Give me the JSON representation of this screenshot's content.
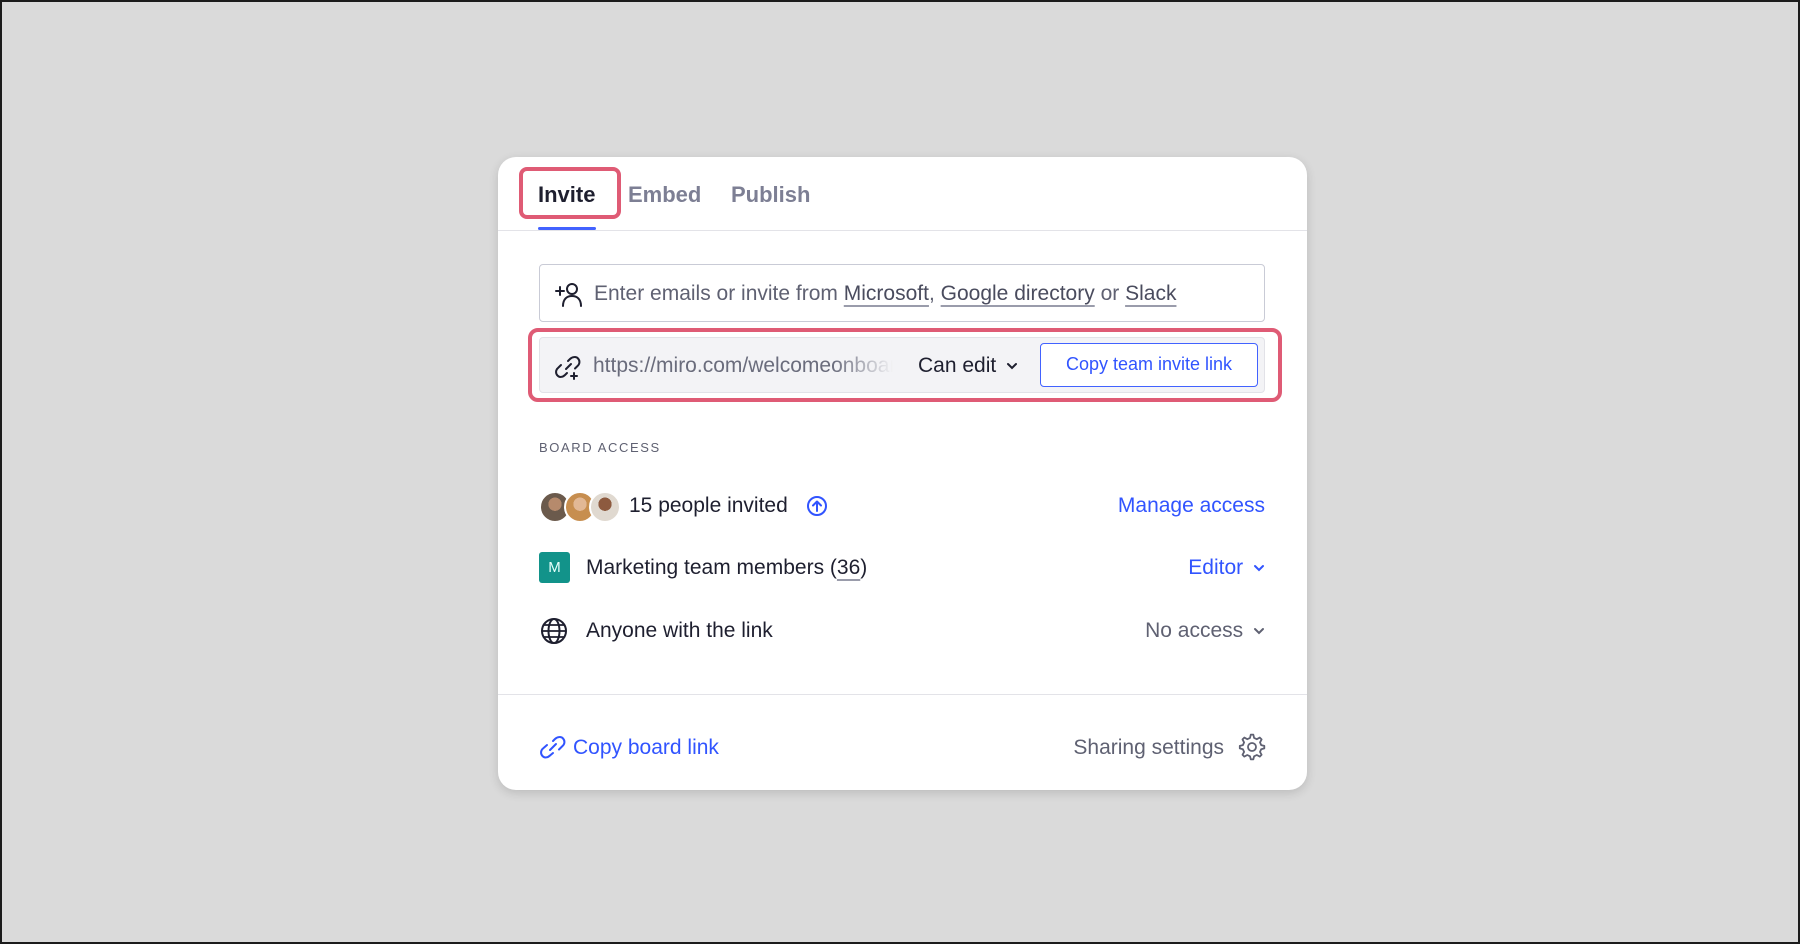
{
  "tabs": [
    {
      "label": "Invite",
      "active": true
    },
    {
      "label": "Embed",
      "active": false
    },
    {
      "label": "Publish",
      "active": false
    }
  ],
  "invite": {
    "email_prefix": "Enter emails or invite from",
    "link_microsoft": "Microsoft",
    "comma": ",",
    "link_google": "Google directory",
    "or": "or",
    "link_slack": "Slack"
  },
  "invite_link": {
    "url": "https://miro.com/welcomeonboard",
    "permission": "Can edit",
    "copy_button": "Copy team invite link"
  },
  "board_access": {
    "label": "BOARD ACCESS",
    "people_invited": "15 people invited",
    "manage_access": "Manage access",
    "team_badge": "M",
    "team_name": "Marketing team members (",
    "team_count": "36",
    "team_close": ")",
    "team_role": "Editor",
    "anyone_label": "Anyone with the link",
    "anyone_role": "No access"
  },
  "footer": {
    "copy_board_link": "Copy board link",
    "sharing_settings": "Sharing settings"
  },
  "colors": {
    "accent": "#4262ff",
    "highlight": "#df5b75",
    "team_badge": "#12938a"
  },
  "icons": [
    "add-person-icon",
    "link-icon",
    "chevron-down-icon",
    "arrow-up-circle-icon",
    "globe-icon",
    "gear-icon"
  ]
}
